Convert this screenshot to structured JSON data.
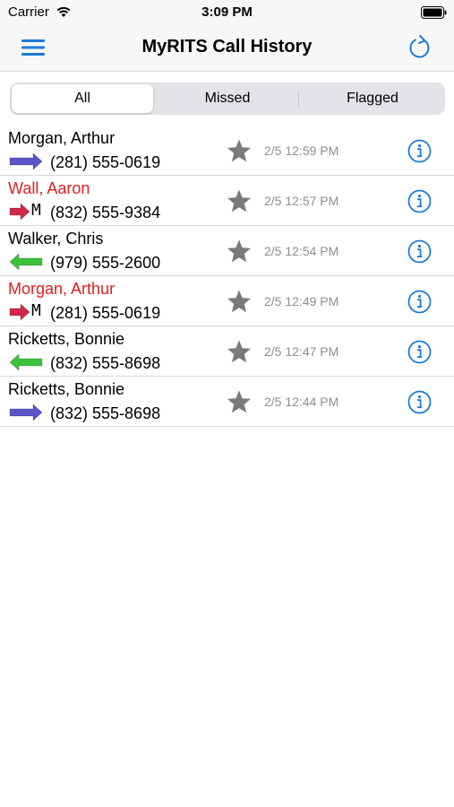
{
  "status_bar": {
    "carrier": "Carrier",
    "time": "3:09 PM"
  },
  "nav": {
    "title": "MyRITS Call History"
  },
  "tabs": [
    {
      "label": "All",
      "selected": true
    },
    {
      "label": "Missed",
      "selected": false
    },
    {
      "label": "Flagged",
      "selected": false
    }
  ],
  "colors": {
    "accent": "#1e7ad6",
    "missed_text": "#e0201e",
    "outgoing_arrow": "#5a55c8",
    "incoming_arrow": "#3cc23c",
    "missed_arrow": "#d02848",
    "star": "#7a7a7a",
    "time_text": "#8e8e93"
  },
  "calls": [
    {
      "name": "Morgan, Arthur",
      "direction": "outgoing",
      "missed": false,
      "mobile": false,
      "mobile_label": "",
      "number": "(281) 555-0619",
      "time": "2/5 12:59 PM"
    },
    {
      "name": "Wall, Aaron",
      "direction": "missed",
      "missed": true,
      "mobile": true,
      "mobile_label": "M",
      "number": "(832) 555-9384",
      "time": "2/5 12:57 PM"
    },
    {
      "name": "Walker, Chris",
      "direction": "incoming",
      "missed": false,
      "mobile": false,
      "mobile_label": "",
      "number": "(979) 555-2600",
      "time": "2/5 12:54 PM"
    },
    {
      "name": "Morgan, Arthur",
      "direction": "missed",
      "missed": true,
      "mobile": true,
      "mobile_label": "M",
      "number": "(281) 555-0619",
      "time": "2/5 12:49 PM"
    },
    {
      "name": "Ricketts, Bonnie",
      "direction": "incoming",
      "missed": false,
      "mobile": false,
      "mobile_label": "",
      "number": "(832) 555-8698",
      "time": "2/5 12:47 PM"
    },
    {
      "name": "Ricketts, Bonnie",
      "direction": "outgoing",
      "missed": false,
      "mobile": false,
      "mobile_label": "",
      "number": "(832) 555-8698",
      "time": "2/5 12:44 PM"
    }
  ]
}
